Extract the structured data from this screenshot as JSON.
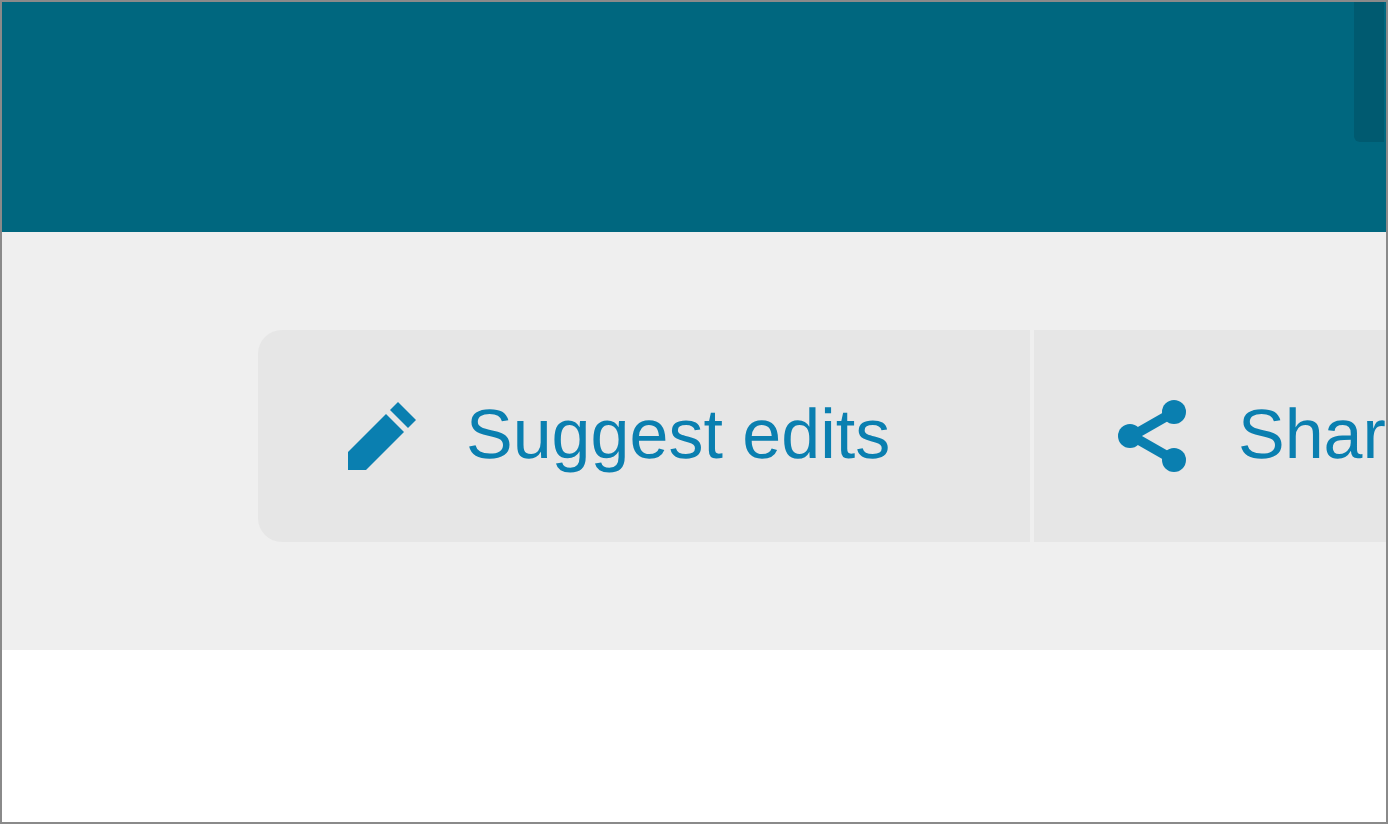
{
  "actions": [
    {
      "kind": "edit",
      "label": "Suggest edits"
    },
    {
      "kind": "share",
      "label": "Shar"
    }
  ]
}
